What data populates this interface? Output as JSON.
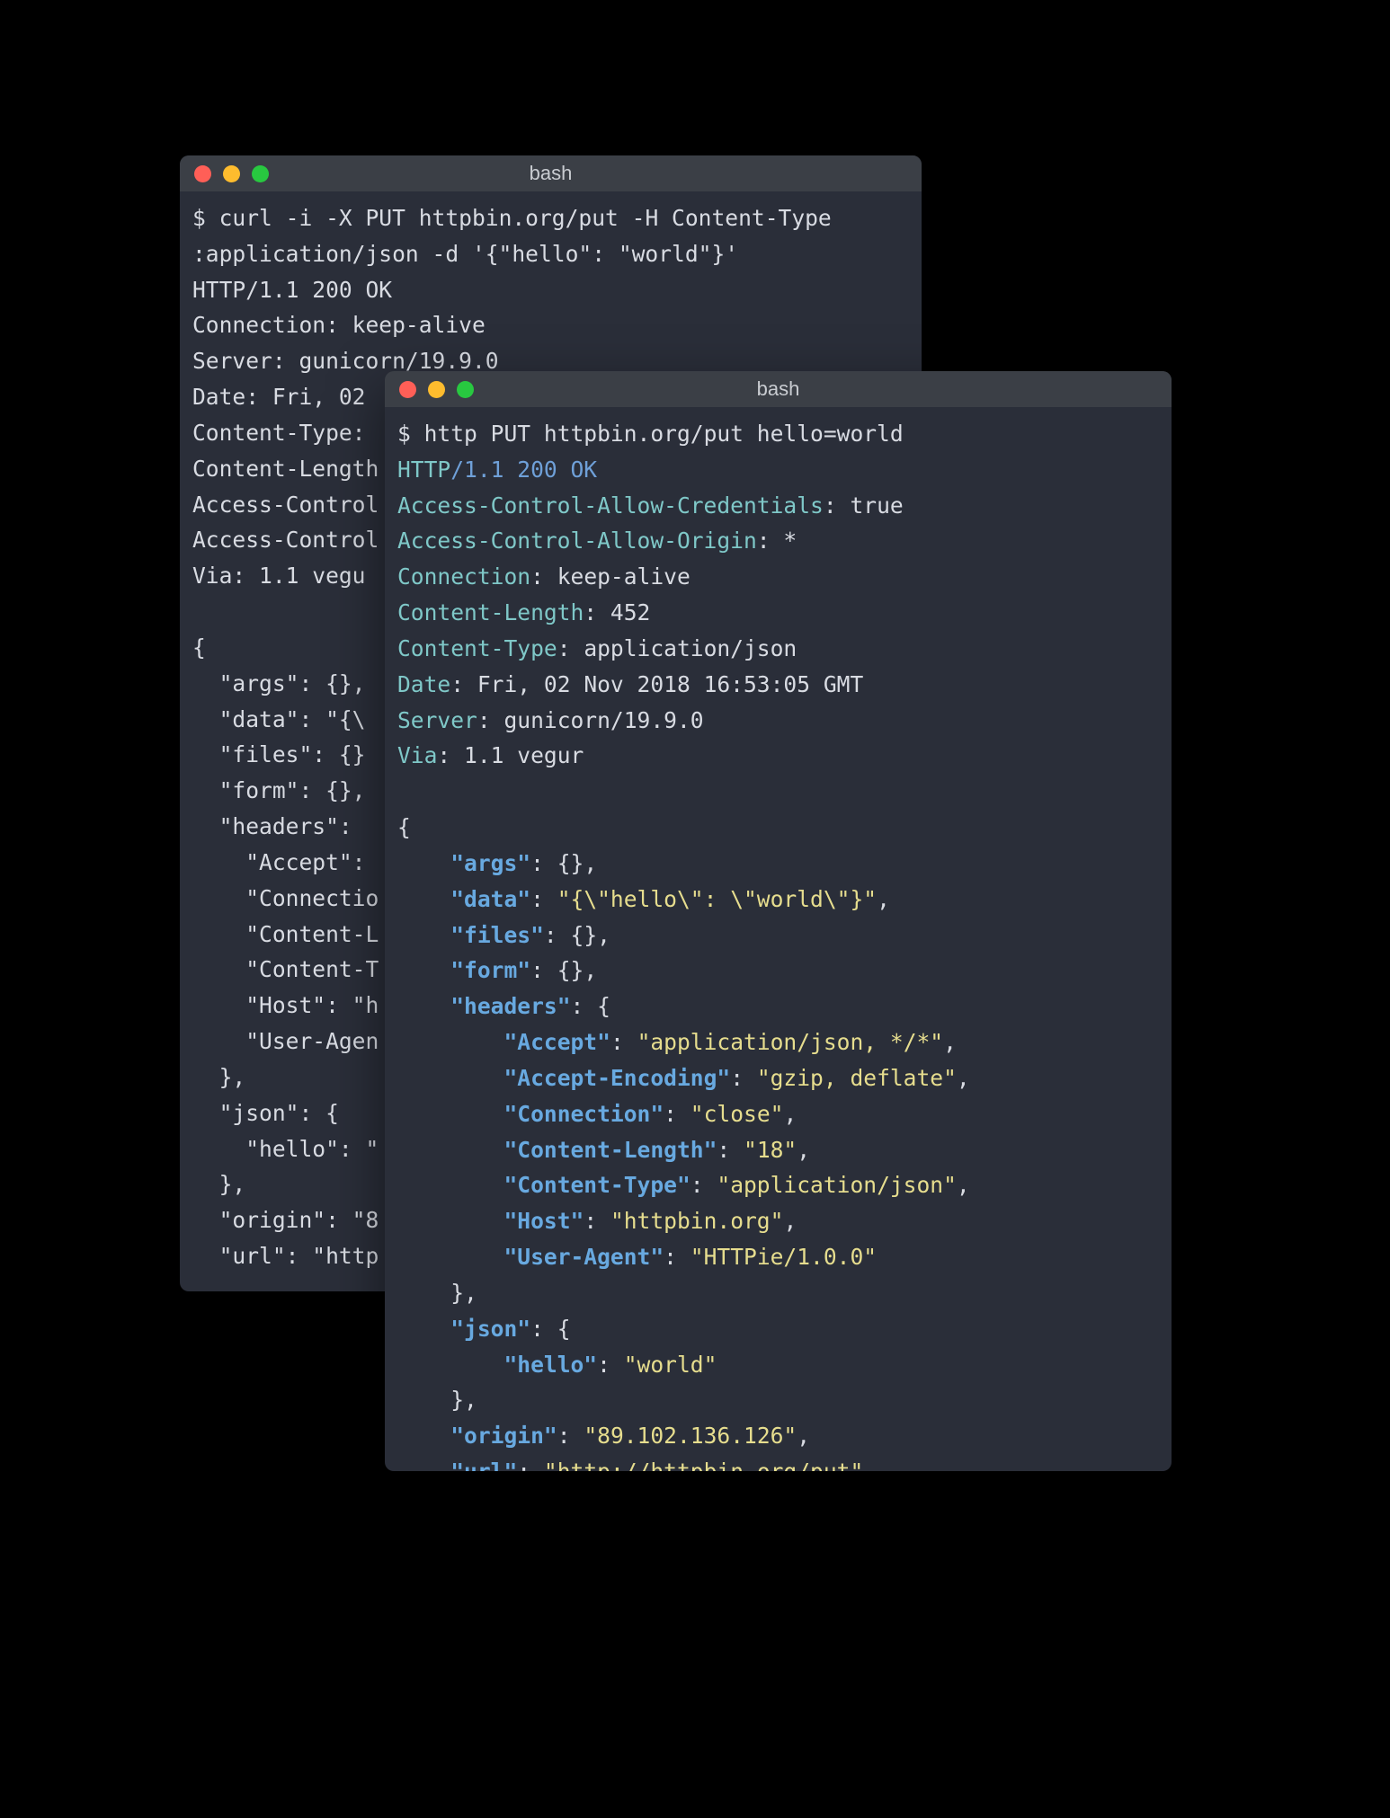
{
  "back": {
    "title": "bash",
    "prompt": "$",
    "command": "curl -i -X PUT httpbin.org/put -H Content-Type\n:application/json -d '{\"hello\": \"world\"}'",
    "headers": [
      "HTTP/1.1 200 OK",
      "Connection: keep-alive",
      "Server: gunicorn/19.9.0",
      "Date: Fri, 02 ",
      "Content-Type: ",
      "Content-Length",
      "Access-Control",
      "Access-Control",
      "Via: 1.1 vegu"
    ],
    "body_lines": [
      "{",
      "  \"args\": {},",
      "  \"data\": \"{\\",
      "  \"files\": {}",
      "  \"form\": {},",
      "  \"headers\": ",
      "    \"Accept\": ",
      "    \"Connectio",
      "    \"Content-L",
      "    \"Content-T",
      "    \"Host\": \"h",
      "    \"User-Agen",
      "  },",
      "  \"json\": {",
      "    \"hello\": \"",
      "  },",
      "  \"origin\": \"8",
      "  \"url\": \"http"
    ]
  },
  "front": {
    "title": "bash",
    "prompt": "$",
    "command": "http PUT httpbin.org/put hello=world",
    "proto": {
      "p": "HTTP",
      "v": "/1.1 200 OK"
    },
    "headers": [
      {
        "k": "Access-Control-Allow-Credentials",
        "v": "true"
      },
      {
        "k": "Access-Control-Allow-Origin",
        "v": "*"
      },
      {
        "k": "Connection",
        "v": "keep-alive"
      },
      {
        "k": "Content-Length",
        "v": "452"
      },
      {
        "k": "Content-Type",
        "v": "application/json"
      },
      {
        "k": "Date",
        "v": "Fri, 02 Nov 2018 16:53:05 GMT"
      },
      {
        "k": "Server",
        "v": "gunicorn/19.9.0"
      },
      {
        "k": "Via",
        "v": "1.1 vegur"
      }
    ],
    "json": {
      "args": "{}",
      "data": "\"{\\\"hello\\\": \\\"world\\\"}\"",
      "files": "{}",
      "form": "{}",
      "headers": [
        {
          "k": "Accept",
          "v": "\"application/json, */*\""
        },
        {
          "k": "Accept-Encoding",
          "v": "\"gzip, deflate\""
        },
        {
          "k": "Connection",
          "v": "\"close\""
        },
        {
          "k": "Content-Length",
          "v": "\"18\""
        },
        {
          "k": "Content-Type",
          "v": "\"application/json\""
        },
        {
          "k": "Host",
          "v": "\"httpbin.org\""
        },
        {
          "k": "User-Agent",
          "v": "\"HTTPie/1.0.0\""
        }
      ],
      "json_inner": {
        "k": "hello",
        "v": "\"world\""
      },
      "origin": "\"89.102.136.126\"",
      "url": "\"http://httpbin.org/put\""
    }
  },
  "colors": {
    "key": "#68a9e0",
    "string": "#e6dd8e",
    "header_key": "#7fc8c8",
    "proto": "#6fa0d8"
  }
}
